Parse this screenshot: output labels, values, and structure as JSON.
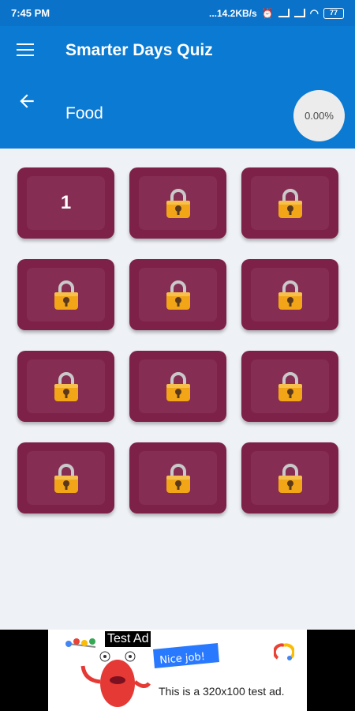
{
  "status_bar": {
    "time": "7:45 PM",
    "network_speed": "...14.2KB/s",
    "battery": "77"
  },
  "app_bar": {
    "title": "Smarter Days Quiz",
    "category": "Food",
    "progress": "0.00%"
  },
  "levels": [
    {
      "label": "1",
      "locked": false
    },
    {
      "label": "",
      "locked": true
    },
    {
      "label": "",
      "locked": true
    },
    {
      "label": "",
      "locked": true
    },
    {
      "label": "",
      "locked": true
    },
    {
      "label": "",
      "locked": true
    },
    {
      "label": "",
      "locked": true
    },
    {
      "label": "",
      "locked": true
    },
    {
      "label": "",
      "locked": true
    },
    {
      "label": "",
      "locked": true
    },
    {
      "label": "",
      "locked": true
    },
    {
      "label": "",
      "locked": true
    }
  ],
  "ad": {
    "badge": "Test Ad",
    "bubble": "Nice job!",
    "text": "This is a 320x100 test ad."
  },
  "colors": {
    "primary": "#0a7ad2",
    "tile": "#7d2149",
    "tile_inner": "#852d52",
    "lock_body": "#f2a516"
  }
}
